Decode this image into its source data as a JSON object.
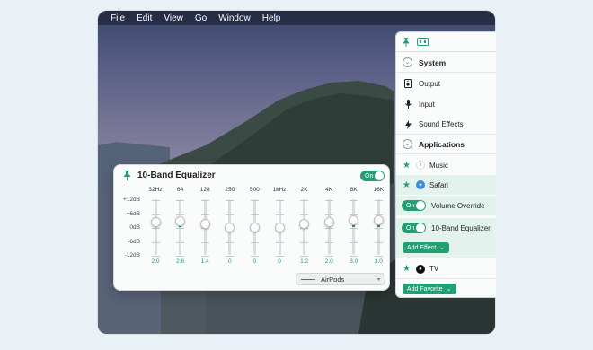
{
  "menubar": {
    "items": [
      "File",
      "Edit",
      "View",
      "Go",
      "Window",
      "Help"
    ]
  },
  "equalizer": {
    "title": "10-Band Equalizer",
    "toggle_label": "On",
    "bands": [
      "32Hz",
      "64",
      "128",
      "250",
      "500",
      "1kHz",
      "2K",
      "4K",
      "8K",
      "16K"
    ],
    "db_labels": [
      "+12dB",
      "+6dB",
      "0dB",
      "-6dB",
      "-12dB"
    ],
    "values": [
      "2.0",
      "2.6",
      "1.4",
      "0",
      "0",
      "0",
      "1.2",
      "2.0",
      "3.0",
      "3.0"
    ],
    "device": "AirPods"
  },
  "panel": {
    "system_heading": "System",
    "output_label": "Output",
    "input_label": "Input",
    "sound_effects_label": "Sound Effects",
    "applications_heading": "Applications",
    "music_label": "Music",
    "safari_label": "Safari",
    "volume_override_label": "Volume Override",
    "eq_label": "10-Band Equalizer",
    "toggle_label": "On",
    "add_effect_label": "Add Effect",
    "tv_label": "TV",
    "add_favorite_label": "Add Favorite"
  },
  "colors": {
    "accent": "#22a072",
    "selected_row": "#e3f2ec"
  }
}
